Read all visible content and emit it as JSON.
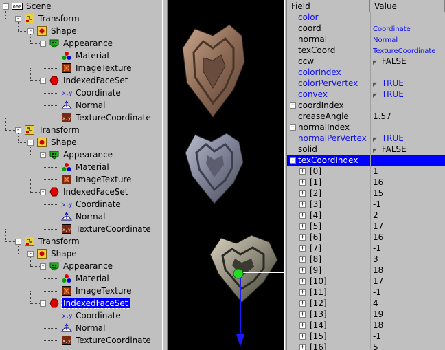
{
  "tree": {
    "nodes": [
      {
        "label": "Scene",
        "icon": "scene-icon",
        "box": "-",
        "selected": false
      },
      {
        "label": "Transform",
        "icon": "transform-icon",
        "box": "-",
        "selected": false
      },
      {
        "label": "Shape",
        "icon": "shape-icon",
        "box": "-",
        "selected": false
      },
      {
        "label": "Appearance",
        "icon": "appearance-icon",
        "box": "-",
        "selected": false
      },
      {
        "label": "Material",
        "icon": "material-icon",
        "box": "",
        "selected": false
      },
      {
        "label": "ImageTexture",
        "icon": "image-texture-icon",
        "box": "",
        "selected": false
      },
      {
        "label": "IndexedFaceSet",
        "icon": "indexed-face-set-icon",
        "box": "-",
        "selected": false
      },
      {
        "label": "Coordinate",
        "icon": "coordinate-icon",
        "box": "",
        "selected": false
      },
      {
        "label": "Normal",
        "icon": "normal-icon",
        "box": "",
        "selected": false
      },
      {
        "label": "TextureCoordinate",
        "icon": "texture-coordinate-icon",
        "box": "",
        "selected": false
      },
      {
        "label": "Transform",
        "icon": "transform-icon",
        "box": "-",
        "selected": false
      },
      {
        "label": "Shape",
        "icon": "shape-icon",
        "box": "-",
        "selected": false
      },
      {
        "label": "Appearance",
        "icon": "appearance-icon",
        "box": "-",
        "selected": false
      },
      {
        "label": "Material",
        "icon": "material-icon",
        "box": "",
        "selected": false
      },
      {
        "label": "ImageTexture",
        "icon": "image-texture-icon",
        "box": "",
        "selected": false
      },
      {
        "label": "IndexedFaceSet",
        "icon": "indexed-face-set-icon",
        "box": "-",
        "selected": false
      },
      {
        "label": "Coordinate",
        "icon": "coordinate-icon",
        "box": "",
        "selected": false
      },
      {
        "label": "Normal",
        "icon": "normal-icon",
        "box": "",
        "selected": false
      },
      {
        "label": "TextureCoordinate",
        "icon": "texture-coordinate-icon",
        "box": "",
        "selected": false
      },
      {
        "label": "Transform",
        "icon": "transform-icon",
        "box": "-",
        "selected": false
      },
      {
        "label": "Shape",
        "icon": "shape-icon",
        "box": "-",
        "selected": false
      },
      {
        "label": "Appearance",
        "icon": "appearance-icon",
        "box": "-",
        "selected": false
      },
      {
        "label": "Material",
        "icon": "material-icon",
        "box": "",
        "selected": false
      },
      {
        "label": "ImageTexture",
        "icon": "image-texture-icon",
        "box": "",
        "selected": false
      },
      {
        "label": "IndexedFaceSet",
        "icon": "indexed-face-set-icon",
        "box": "-",
        "selected": true
      },
      {
        "label": "Coordinate",
        "icon": "coordinate-icon",
        "box": "",
        "selected": false
      },
      {
        "label": "Normal",
        "icon": "normal-icon",
        "box": "",
        "selected": false
      },
      {
        "label": "TextureCoordinate",
        "icon": "texture-coordinate-icon",
        "box": "",
        "selected": false
      }
    ]
  },
  "viewport": {
    "background": "#000000",
    "objects": [
      "heart-model-1",
      "heart-model-2",
      "heart-model-3"
    ]
  },
  "props": {
    "header": {
      "field": "Field",
      "value": "Value"
    },
    "rows": [
      {
        "field": "color",
        "value": "",
        "field_style": "blue",
        "value_style": "",
        "box": "",
        "check": false,
        "selected": false
      },
      {
        "field": "coord",
        "value": "Coordinate",
        "field_style": "",
        "value_style": "blue small",
        "box": "",
        "check": false,
        "selected": false
      },
      {
        "field": "normal",
        "value": "Normal",
        "field_style": "",
        "value_style": "blue small",
        "box": "",
        "check": false,
        "selected": false
      },
      {
        "field": "texCoord",
        "value": "TextureCoordinate",
        "field_style": "",
        "value_style": "blue small",
        "box": "",
        "check": false,
        "selected": false
      },
      {
        "field": "ccw",
        "value": "FALSE",
        "field_style": "",
        "value_style": "",
        "box": "",
        "check": true,
        "selected": false
      },
      {
        "field": "colorIndex",
        "value": "",
        "field_style": "blue",
        "value_style": "",
        "box": "",
        "check": false,
        "selected": false
      },
      {
        "field": "colorPerVertex",
        "value": "TRUE",
        "field_style": "blue",
        "value_style": "blue",
        "box": "",
        "check": true,
        "selected": false
      },
      {
        "field": "convex",
        "value": "TRUE",
        "field_style": "blue",
        "value_style": "blue",
        "box": "",
        "check": true,
        "selected": false
      },
      {
        "field": "coordIndex",
        "value": "",
        "field_style": "",
        "value_style": "",
        "box": "+",
        "check": false,
        "selected": false
      },
      {
        "field": "creaseAngle",
        "value": "1.57",
        "field_style": "",
        "value_style": "",
        "box": "",
        "check": false,
        "selected": false
      },
      {
        "field": "normalIndex",
        "value": "",
        "field_style": "",
        "value_style": "",
        "box": "+",
        "check": false,
        "selected": false
      },
      {
        "field": "normalPerVertex",
        "value": "TRUE",
        "field_style": "blue",
        "value_style": "blue",
        "box": "",
        "check": true,
        "selected": false
      },
      {
        "field": "solid",
        "value": "FALSE",
        "field_style": "",
        "value_style": "",
        "box": "",
        "check": true,
        "selected": false
      },
      {
        "field": "texCoordIndex",
        "value": "",
        "field_style": "",
        "value_style": "",
        "box": "-",
        "check": false,
        "selected": true
      },
      {
        "field": "[0]",
        "value": "1",
        "box": "+",
        "sub": true
      },
      {
        "field": "[1]",
        "value": "16",
        "box": "+",
        "sub": true
      },
      {
        "field": "[2]",
        "value": "15",
        "box": "+",
        "sub": true
      },
      {
        "field": "[3]",
        "value": "-1",
        "box": "+",
        "sub": true
      },
      {
        "field": "[4]",
        "value": "2",
        "box": "+",
        "sub": true
      },
      {
        "field": "[5]",
        "value": "17",
        "box": "+",
        "sub": true
      },
      {
        "field": "[6]",
        "value": "16",
        "box": "+",
        "sub": true
      },
      {
        "field": "[7]",
        "value": "-1",
        "box": "+",
        "sub": true
      },
      {
        "field": "[8]",
        "value": "3",
        "box": "+",
        "sub": true
      },
      {
        "field": "[9]",
        "value": "18",
        "box": "+",
        "sub": true
      },
      {
        "field": "[10]",
        "value": "17",
        "box": "+",
        "sub": true
      },
      {
        "field": "[11]",
        "value": "-1",
        "box": "+",
        "sub": true
      },
      {
        "field": "[12]",
        "value": "4",
        "box": "+",
        "sub": true
      },
      {
        "field": "[13]",
        "value": "19",
        "box": "+",
        "sub": true
      },
      {
        "field": "[14]",
        "value": "18",
        "box": "+",
        "sub": true
      },
      {
        "field": "[15]",
        "value": "-1",
        "box": "+",
        "sub": true
      },
      {
        "field": "[16]",
        "value": "5",
        "box": "+",
        "sub": true
      }
    ]
  }
}
